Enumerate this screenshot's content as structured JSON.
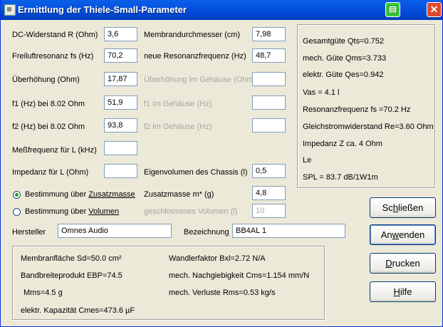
{
  "window": {
    "title": "Ermittlung der Thiele-Small-Parameter"
  },
  "left": {
    "dc_label": "DC-Widerstand R (Ohm)",
    "dc_value": "3,6",
    "fs_label": "Freiluftresonanz fs (Hz)",
    "fs_value": "70,2",
    "ueber_label": "Überhöhung (Ohm)",
    "ueber_value": "17,87",
    "f1_label": "f1 (Hz) bei 8.02 Ohm",
    "f1_value": "51,9",
    "f2_label": "f2 (Hz) bei 8.02 Ohm",
    "f2_value": "93,8",
    "messf_label": "Meßfrequenz für L (kHz)",
    "messf_value": "",
    "imp_label": "Impedanz für L (Ohm)",
    "imp_value": ""
  },
  "middle": {
    "md_label": "Membrandurchmesser (cm)",
    "md_value": "7,98",
    "nres_label": "neue Resonanzfrequenz (Hz)",
    "nres_value": "48,7",
    "ueg_label": "Überhöhung im Gehäuse (Ohm)",
    "ueg_value": "",
    "f1g_label": "f1 im Gehäuse (Hz)",
    "f1g_value": "",
    "f2g_label": "f2 im Gehäuse (Hz)",
    "f2g_value": "",
    "eig_label": "Eigenvolumen des Chassis (l)",
    "eig_value": "0,5",
    "zm_label": "Zusatzmasse m* (g)",
    "zm_value": "4,8",
    "gv_label": "geschlossenes Volumen (l)",
    "gv_value": "10"
  },
  "radios": {
    "zusatz_pre": "Bestimmung über ",
    "zusatz_key": "Zusatzmasse",
    "volumen_pre": "Bestimmung über ",
    "volumen_key": "Volumen"
  },
  "maker": {
    "label": "Hersteller",
    "value": "Omnes Audio"
  },
  "model": {
    "label": "Bezeichnung",
    "value": "BB4AL 1"
  },
  "results": {
    "qts": "Gesamtgüte Qts=0.752",
    "qms": "mech. Güte Qms=3.733",
    "qes": "elektr. Güte Qes=0.942",
    "vas": "Vas = 4.1 l",
    "fs": "Resonanzfrequenz fs =70.2 Hz",
    "re": "Gleichstromwiderstand Re=3.60 Ohm",
    "z": "Impedanz Z ca.  4 Ohm",
    "le": "Le",
    "spl": "SPL = 83.7 dB/1W1m"
  },
  "bottom": {
    "sd": "Membranfläche Sd=50.0 cm²",
    "ebp": "Bandbreiteprodukt EBP=74.5",
    "mms": "Mms=4.5 g",
    "cmes": "elektr. Kapazität Cmes=473.6 µF",
    "bxl": "Wandlerfaktor Bxl=2.72 N/A",
    "cms": "mech. Nachgiebigkeit Cms=1.154 mm/N",
    "rms": "mech. Verluste Rms=0.53 kg/s"
  },
  "buttons": {
    "close_pre": "Sc",
    "close_key": "h",
    "close_post": "ließen",
    "apply_pre": "An",
    "apply_key": "w",
    "apply_post": "enden",
    "print_pre": "",
    "print_key": "D",
    "print_post": "rucken",
    "help_pre": "",
    "help_key": "H",
    "help_post": "ilfe"
  },
  "icons": {
    "help": "help-icon",
    "close": "close-icon"
  }
}
